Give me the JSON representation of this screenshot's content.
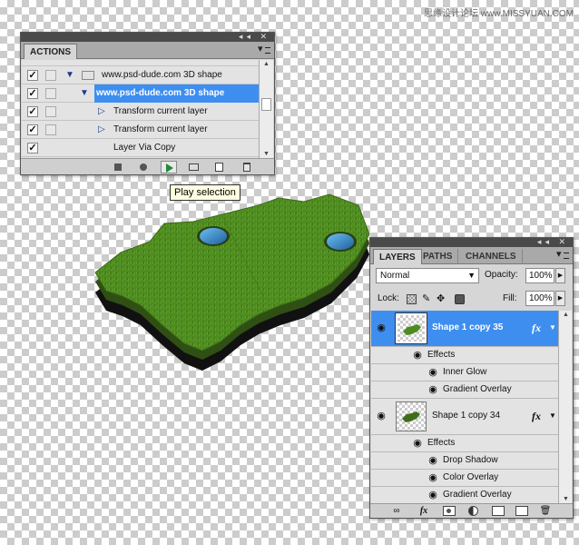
{
  "watermark": "思缘设计论坛 www.MISSYUAN.COM",
  "actions_panel": {
    "tab_label": "ACTIONS",
    "rows": [
      {
        "label": "www.psd-dude.com 3D shape",
        "checked": true,
        "kind": "set"
      },
      {
        "label": "www.psd-dude.com 3D shape",
        "checked": true,
        "kind": "action",
        "selected": true
      },
      {
        "label": "Transform current layer",
        "checked": true,
        "kind": "step"
      },
      {
        "label": "Transform current layer",
        "checked": true,
        "kind": "step"
      },
      {
        "label": "Layer Via Copy",
        "checked": true,
        "kind": "step"
      }
    ],
    "footer_buttons": [
      "stop-icon",
      "record-icon",
      "play-icon",
      "folder-icon",
      "new-action-icon",
      "trash-icon"
    ]
  },
  "tooltip": "Play selection",
  "layers_panel": {
    "tabs": [
      "LAYERS",
      "PATHS",
      "CHANNELS"
    ],
    "blend_mode": "Normal",
    "opacity_label": "Opacity:",
    "opacity_value": "100%",
    "lock_label": "Lock:",
    "fill_label": "Fill:",
    "fill_value": "100%",
    "layers": [
      {
        "name": "Shape 1 copy 35",
        "selected": true,
        "effects_label": "Effects",
        "effects": [
          "Inner Glow",
          "Gradient Overlay"
        ]
      },
      {
        "name": "Shape 1 copy 34",
        "selected": false,
        "effects_label": "Effects",
        "effects": [
          "Drop Shadow",
          "Color Overlay",
          "Gradient Overlay"
        ]
      }
    ],
    "fx_glyph": "fx"
  },
  "colors": {
    "selection": "#3e8ef0",
    "grass": "#4d8a1f",
    "water": "#2d7fbf",
    "panel": "#d6d6d6"
  }
}
